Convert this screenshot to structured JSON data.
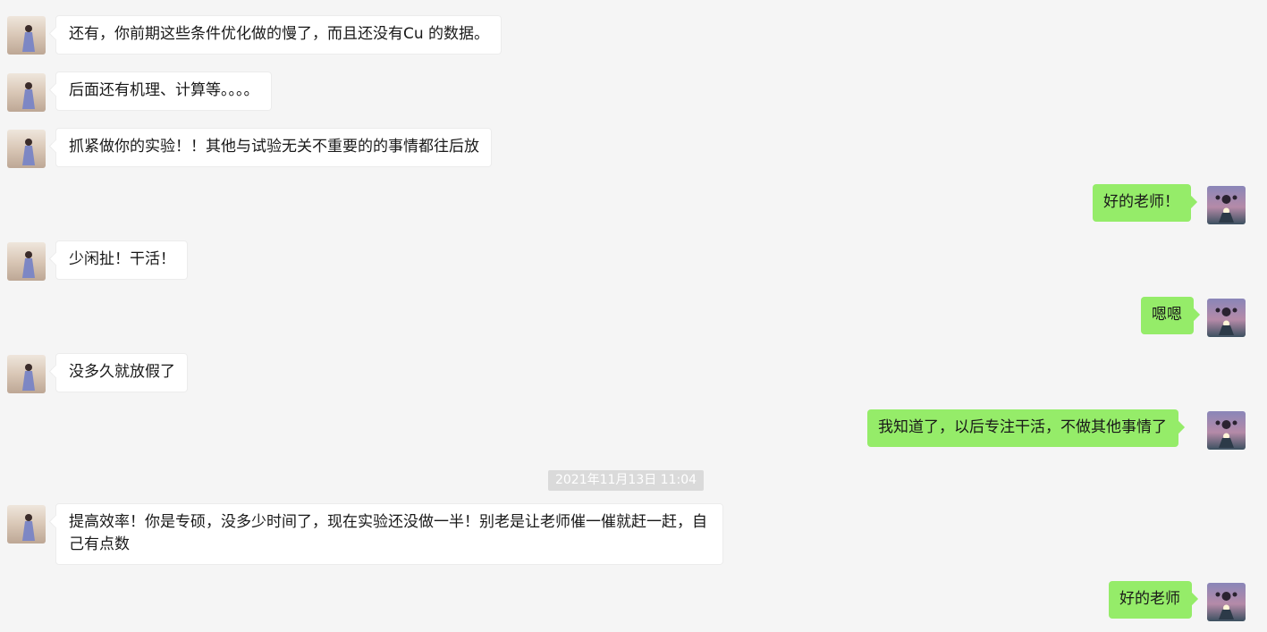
{
  "messages": [
    {
      "side": "left",
      "text": "还有，你前期这些条件优化做的慢了，而且还没有Cu 的数据。"
    },
    {
      "side": "left",
      "text": "后面还有机理、计算等。。。。"
    },
    {
      "side": "left",
      "text": "抓紧做你的实验！！其他与试验无关不重要的的事情都往后放"
    },
    {
      "side": "right",
      "text": "好的老师！"
    },
    {
      "side": "left",
      "text": "少闲扯！干活！"
    },
    {
      "side": "right",
      "text": "嗯嗯"
    },
    {
      "side": "left",
      "text": "没多久就放假了"
    },
    {
      "side": "right",
      "text": "我知道了，以后专注干活，不做其他事情了"
    },
    {
      "side": "left",
      "text": "提高效率！你是专硕，没多少时间了，现在实验还没做一半！别老是让老师催一催就赶一赶，自己有点数"
    },
    {
      "side": "right",
      "text": "好的老师"
    }
  ],
  "timestamp": "2021年11月13日 11:04",
  "colors": {
    "background": "#f5f5f5",
    "incoming_bubble": "#ffffff",
    "outgoing_bubble": "#95ec69",
    "timestamp_bg": "#dadada"
  },
  "icons": {
    "incoming_avatar": "contact-avatar-icon",
    "outgoing_avatar": "user-avatar-icon"
  }
}
